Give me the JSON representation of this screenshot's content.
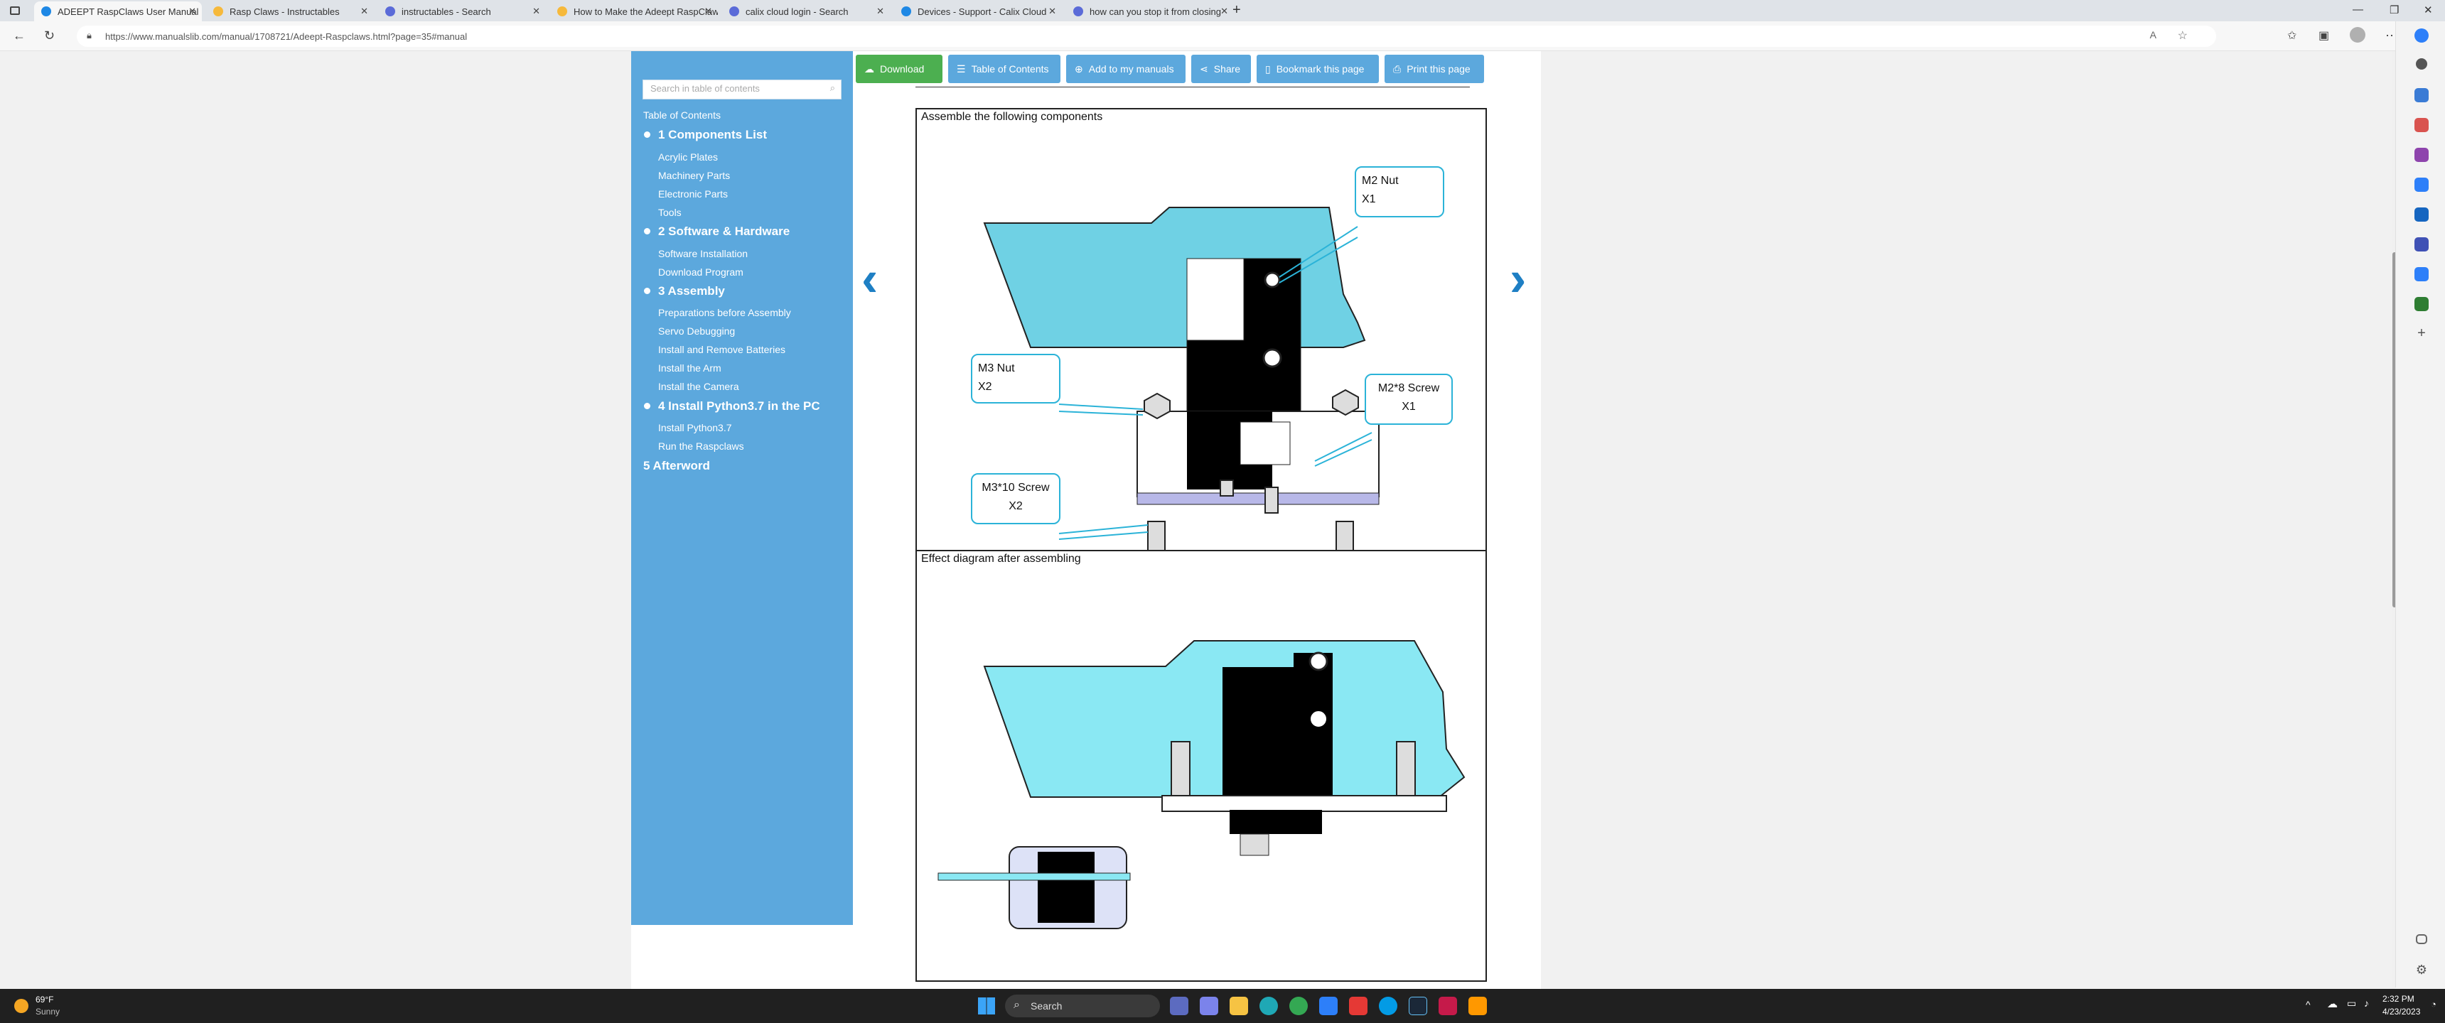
{
  "browser": {
    "tabs": [
      {
        "label": "ADEEPT RaspClaws User Manual",
        "color": "#1e88e5"
      },
      {
        "label": "Rasp Claws - Instructables",
        "color": "#f6b93b"
      },
      {
        "label": "instructables - Search",
        "color": "#5b6bd8"
      },
      {
        "label": "How to Make the Adeept RaspClaws",
        "color": "#f6b93b"
      },
      {
        "label": "calix cloud login - Search",
        "color": "#5b6bd8"
      },
      {
        "label": "Devices - Support - Calix Cloud",
        "color": "#1e88e5"
      },
      {
        "label": "how can you stop it from closing",
        "color": "#5b6bd8"
      }
    ],
    "new_tab": "+",
    "url": "https://www.manualslib.com/manual/1708721/Adeept-Raspclaws.html?page=35#manual"
  },
  "toolbar": {
    "download": "Download",
    "toc": "Table of Contents",
    "add": "Add to my manuals",
    "share": "Share",
    "bookmark": "Bookmark this page",
    "print": "Print this page"
  },
  "sidebar": {
    "search_placeholder": "Search in table of contents",
    "title": "Table of Contents",
    "sections": [
      {
        "heading": "1 Components List",
        "items": [
          "Acrylic Plates",
          "Machinery Parts",
          "Electronic Parts",
          "Tools"
        ]
      },
      {
        "heading": "2 Software & Hardware",
        "items": [
          "Software Installation",
          "Download Program"
        ]
      },
      {
        "heading": "3 Assembly",
        "items": [
          "Preparations before Assembly",
          "Servo Debugging",
          "Install and Remove Batteries",
          "Install the Arm",
          "Install the Camera"
        ]
      },
      {
        "heading": "4 Install Python3.7 in the PC",
        "items": [
          "Install Python3.7",
          "Run the Raspclaws"
        ]
      }
    ],
    "last": "5 Afterword"
  },
  "manual": {
    "caption_top": "Assemble the following components",
    "caption_bottom": "Effect diagram after assembling",
    "callouts": {
      "m2nut": [
        "M2 Nut",
        "X1"
      ],
      "m3nut": [
        "M3 Nut",
        "X2"
      ],
      "m2screw": [
        "M2*8 Screw",
        "X1"
      ],
      "m3screw": [
        "M3*10 Screw",
        "X2"
      ]
    },
    "prev": "‹",
    "next": "›"
  },
  "taskbar": {
    "temp": "69°F",
    "weather": "Sunny",
    "search": "Search",
    "time": "2:32 PM",
    "date": "4/23/2023"
  },
  "colors": {
    "accent": "#5ca8dd",
    "green": "#4caf50",
    "acrylic": "#7fd7e6"
  }
}
